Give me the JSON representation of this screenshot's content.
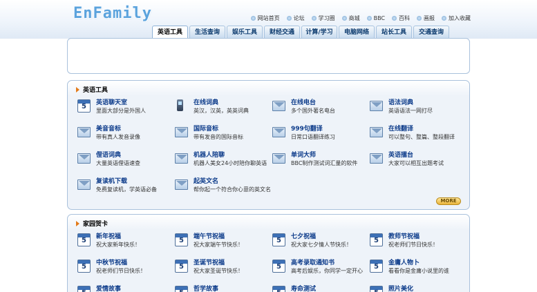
{
  "header": {
    "logo": "EnFamily",
    "links": [
      {
        "label": "网站首页",
        "icon": "home-icon"
      },
      {
        "label": "论坛",
        "icon": "forum-icon"
      },
      {
        "label": "学习圈",
        "icon": "circle-icon"
      },
      {
        "label": "商城",
        "icon": "shop-icon"
      },
      {
        "label": "BBC",
        "icon": "bbc-icon"
      },
      {
        "label": "百科",
        "icon": "wiki-icon"
      },
      {
        "label": "画报",
        "icon": "pictorial-icon"
      },
      {
        "label": "加入收藏",
        "icon": "favorite-icon"
      }
    ]
  },
  "tabs": [
    "英语工具",
    "生活查询",
    "娱乐工具",
    "财经交通",
    "计算/学习",
    "电脑网络",
    "站长工具",
    "交通查询"
  ],
  "active_tab": "英语工具",
  "panel1": {
    "title": "英语工具",
    "more": "MORE",
    "items": [
      {
        "name": "英语聊天室",
        "desc": "里面大部分是外国人",
        "icon": "calendar-icon"
      },
      {
        "name": "在线词典",
        "desc": "英汉，汉英，英英词典",
        "icon": "phone-icon"
      },
      {
        "name": "在线电台",
        "desc": "多个国外著名电台",
        "icon": "mail-icon"
      },
      {
        "name": "语法词典",
        "desc": "英语语法一网打尽",
        "icon": "mail-icon"
      },
      {
        "name": "美音音标",
        "desc": "带有真人发音录像",
        "icon": "mail-icon"
      },
      {
        "name": "国际音标",
        "desc": "带有发音的国际音标",
        "icon": "mail-icon"
      },
      {
        "name": "999句翻译",
        "desc": "日常口语翻译练习",
        "icon": "mail-icon"
      },
      {
        "name": "在线翻译",
        "desc": "可以整句、整篇、整段翻译",
        "icon": "mail-icon"
      },
      {
        "name": "俚语词典",
        "desc": "大量英语俚语速查",
        "icon": "mail-icon"
      },
      {
        "name": "机器人陪聊",
        "desc": "机器人美女24小时陪你聊英语",
        "icon": "mail-icon"
      },
      {
        "name": "单词大师",
        "desc": "BBC制作测试词汇量的软件",
        "icon": "mail-icon"
      },
      {
        "name": "英语擂台",
        "desc": "大家可以相互出题考试",
        "icon": "mail-icon"
      },
      {
        "name": "复读机下载",
        "desc": "免费复读机，学英语必备",
        "icon": "mail-icon"
      },
      {
        "name": "起英文名",
        "desc": "帮你起一个符合你心意的英文名",
        "icon": "mail-icon"
      }
    ]
  },
  "panel2": {
    "title": "家园贺卡",
    "items": [
      {
        "name": "新年祝福",
        "desc": "祝大家新年快乐！",
        "icon": "calendar-icon"
      },
      {
        "name": "端午节祝福",
        "desc": "祝大家端午节快乐！",
        "icon": "calendar-icon"
      },
      {
        "name": "七夕祝福",
        "desc": "祝大家七夕情人节快乐！",
        "icon": "calendar-icon"
      },
      {
        "name": "教师节祝福",
        "desc": "祝老师们节日快乐！",
        "icon": "calendar-icon"
      },
      {
        "name": "中秋节祝福",
        "desc": "祝老师们节日快乐！",
        "icon": "calendar-icon"
      },
      {
        "name": "圣诞节祝福",
        "desc": "祝大家圣诞节快乐！",
        "icon": "calendar-icon"
      },
      {
        "name": "高考录取通知书",
        "desc": "高考后娱乐，你同学一定开心",
        "icon": "calendar-icon"
      },
      {
        "name": "金庸人物卜",
        "desc": "看看你是金庸小说里的谁",
        "icon": "calendar-icon"
      },
      {
        "name": "爱情故事",
        "desc": "",
        "icon": "calendar-icon"
      },
      {
        "name": "哲学故事",
        "desc": "",
        "icon": "calendar-icon"
      },
      {
        "name": "寿命测试",
        "desc": "",
        "icon": "calendar-icon"
      },
      {
        "name": "照片美化",
        "desc": "",
        "icon": "calendar-icon"
      }
    ]
  }
}
